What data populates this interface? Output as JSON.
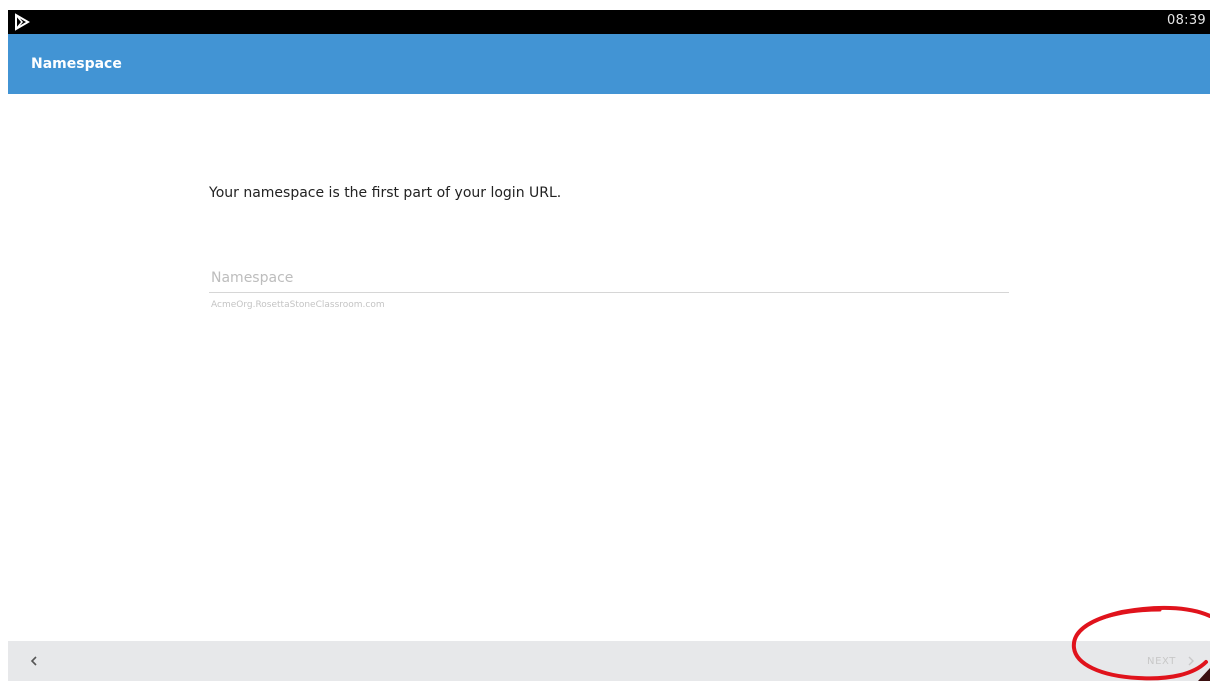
{
  "status_bar": {
    "notification_icon": "play-store-icon",
    "time": "08:39"
  },
  "app_bar": {
    "title": "Namespace"
  },
  "content": {
    "instruction": "Your namespace is the first part of your login URL.",
    "namespace_field": {
      "placeholder": "Namespace",
      "value": "",
      "helper": "AcmeOrg.RosettaStoneClassroom.com"
    }
  },
  "bottom_bar": {
    "back_icon": "chevron-left-icon",
    "next_label": "NEXT",
    "next_icon": "chevron-right-icon"
  },
  "colors": {
    "app_bar": "#4294d4",
    "status_bar": "#000000",
    "bottom_bar": "#e7e8ea",
    "annotation": "#e0131c"
  }
}
